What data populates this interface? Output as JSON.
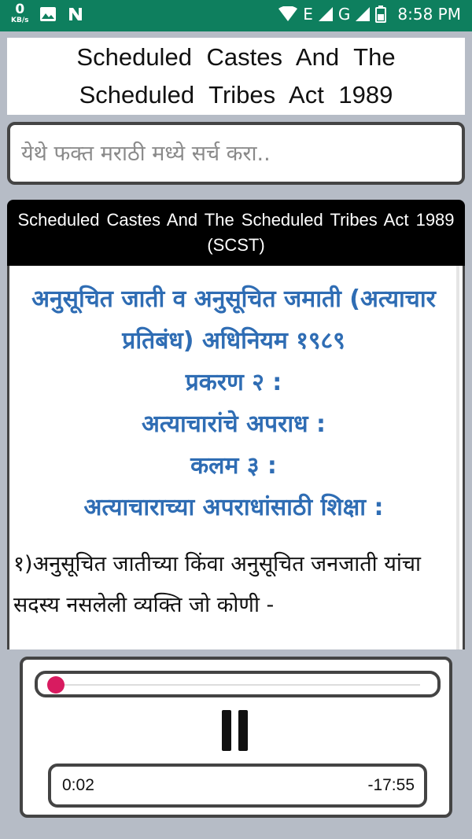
{
  "status_bar": {
    "speed_value": "0",
    "speed_unit": "KB/s",
    "network_label_1": "E",
    "network_label_2": "G",
    "time": "8:58 PM",
    "icons": [
      "image-icon",
      "n-icon",
      "wifi-icon",
      "signal-icon",
      "battery-icon"
    ]
  },
  "app": {
    "title": "Scheduled Castes And The Scheduled Tribes Act 1989"
  },
  "search": {
    "placeholder": "येथे फक्त मराठी मध्ये सर्च करा.."
  },
  "document": {
    "header": "Scheduled Castes And The Scheduled Tribes Act 1989 (SCST)",
    "headings": [
      "अनुसूचित जाती व अनुसूचित जमाती (अत्याचार प्रतिबंध) अधिनियम  १९८९",
      "प्रकरण २ :",
      "अत्याचारांचे अपराध :",
      "कलम ३ :",
      "अत्याचाराच्या अपराधांसाठी शिक्षा :"
    ],
    "paragraph": "१)अनुसूचित जातीच्या किंवा अनुसूचित जनजाती यांचा सदस्य नसलेली व्यक्ति जो कोणी -"
  },
  "player": {
    "progress": 0.002,
    "elapsed": "0:02",
    "remaining": "-17:55",
    "accent_color": "#d81b60"
  }
}
